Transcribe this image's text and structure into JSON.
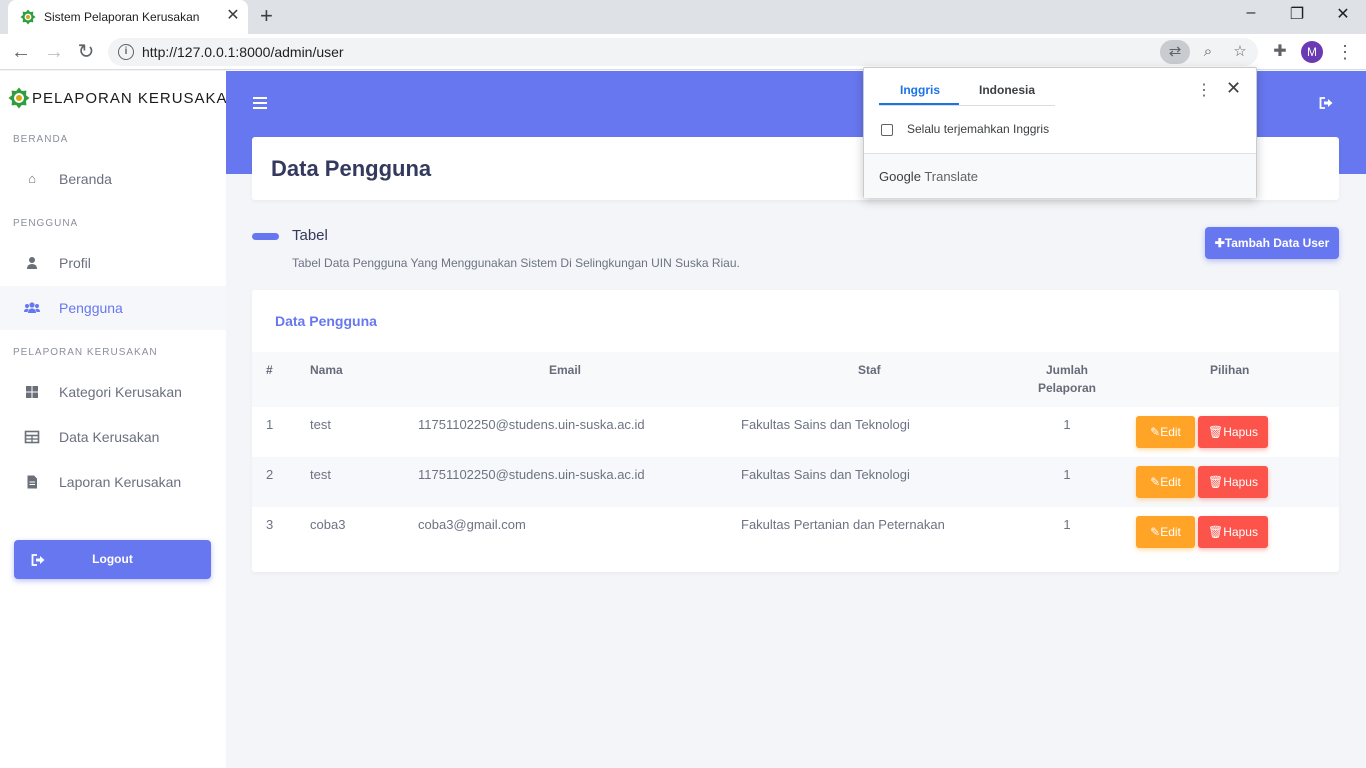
{
  "browser": {
    "tab_title": "Sistem Pelaporan Kerusakan",
    "url": "http://127.0.0.1:8000/admin/user",
    "avatar_letter": "M"
  },
  "translate": {
    "tab_source": "Inggris",
    "tab_target": "Indonesia",
    "always_label": "Selalu terjemahkan Inggris",
    "brand_google": "Google",
    "brand_translate": "Translate"
  },
  "sidebar": {
    "brand": "PELAPORAN KERUSAKAN",
    "sections": [
      {
        "heading": "BERANDA",
        "items": [
          {
            "label": "Beranda",
            "icon": "home-icon"
          }
        ]
      },
      {
        "heading": "PENGGUNA",
        "items": [
          {
            "label": "Profil",
            "icon": "user-icon"
          },
          {
            "label": "Pengguna",
            "icon": "users-icon",
            "active": true
          }
        ]
      },
      {
        "heading": "PELAPORAN KERUSAKAN",
        "items": [
          {
            "label": "Kategori Kerusakan",
            "icon": "grid-icon"
          },
          {
            "label": "Data Kerusakan",
            "icon": "table-icon"
          },
          {
            "label": "Laporan Kerusakan",
            "icon": "file-icon"
          }
        ]
      }
    ],
    "logout_label": "Logout"
  },
  "main": {
    "page_title": "Data Pengguna",
    "section_title": "Tabel",
    "section_desc": "Tabel Data Pengguna Yang Menggunakan Sistem Di Selingkungan UIN Suska Riau.",
    "add_button": "Tambah Data User",
    "table_title": "Data Pengguna",
    "columns": [
      "#",
      "Nama",
      "Email",
      "Staf",
      "Jumlah",
      "Pelaporan",
      "Pilihan"
    ],
    "rows": [
      {
        "no": "1",
        "nama": "test",
        "email": "11751102250@studens.uin-suska.ac.id",
        "staf": "Fakultas Sains dan Teknologi",
        "jumlah": "1",
        "edit": "Edit",
        "hapus": "Hapus"
      },
      {
        "no": "2",
        "nama": "test",
        "email": "11751102250@studens.uin-suska.ac.id",
        "staf": "Fakultas Sains dan Teknologi",
        "jumlah": "1",
        "edit": "Edit",
        "hapus": "Hapus"
      },
      {
        "no": "3",
        "nama": "coba3",
        "email": "coba3@gmail.com",
        "staf": "Fakultas Pertanian dan Peternakan",
        "jumlah": "1",
        "edit": "Edit",
        "hapus": "Hapus"
      }
    ]
  },
  "colors": {
    "primary": "#6777ef",
    "warning": "#ffa426",
    "danger": "#fc544b"
  }
}
